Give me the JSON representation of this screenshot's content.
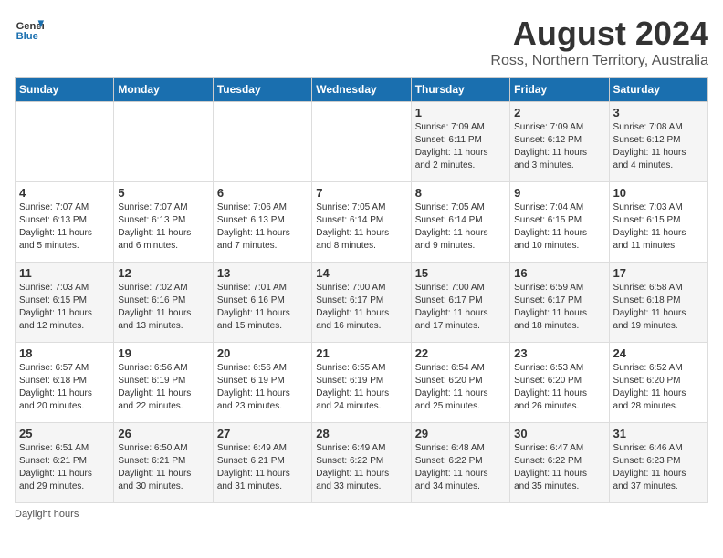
{
  "header": {
    "logo_line1": "General",
    "logo_line2": "Blue",
    "main_title": "August 2024",
    "subtitle": "Ross, Northern Territory, Australia"
  },
  "days_of_week": [
    "Sunday",
    "Monday",
    "Tuesday",
    "Wednesday",
    "Thursday",
    "Friday",
    "Saturday"
  ],
  "weeks": [
    [
      {
        "num": "",
        "info": ""
      },
      {
        "num": "",
        "info": ""
      },
      {
        "num": "",
        "info": ""
      },
      {
        "num": "",
        "info": ""
      },
      {
        "num": "1",
        "info": "Sunrise: 7:09 AM\nSunset: 6:11 PM\nDaylight: 11 hours\nand 2 minutes."
      },
      {
        "num": "2",
        "info": "Sunrise: 7:09 AM\nSunset: 6:12 PM\nDaylight: 11 hours\nand 3 minutes."
      },
      {
        "num": "3",
        "info": "Sunrise: 7:08 AM\nSunset: 6:12 PM\nDaylight: 11 hours\nand 4 minutes."
      }
    ],
    [
      {
        "num": "4",
        "info": "Sunrise: 7:07 AM\nSunset: 6:13 PM\nDaylight: 11 hours\nand 5 minutes."
      },
      {
        "num": "5",
        "info": "Sunrise: 7:07 AM\nSunset: 6:13 PM\nDaylight: 11 hours\nand 6 minutes."
      },
      {
        "num": "6",
        "info": "Sunrise: 7:06 AM\nSunset: 6:13 PM\nDaylight: 11 hours\nand 7 minutes."
      },
      {
        "num": "7",
        "info": "Sunrise: 7:05 AM\nSunset: 6:14 PM\nDaylight: 11 hours\nand 8 minutes."
      },
      {
        "num": "8",
        "info": "Sunrise: 7:05 AM\nSunset: 6:14 PM\nDaylight: 11 hours\nand 9 minutes."
      },
      {
        "num": "9",
        "info": "Sunrise: 7:04 AM\nSunset: 6:15 PM\nDaylight: 11 hours\nand 10 minutes."
      },
      {
        "num": "10",
        "info": "Sunrise: 7:03 AM\nSunset: 6:15 PM\nDaylight: 11 hours\nand 11 minutes."
      }
    ],
    [
      {
        "num": "11",
        "info": "Sunrise: 7:03 AM\nSunset: 6:15 PM\nDaylight: 11 hours\nand 12 minutes."
      },
      {
        "num": "12",
        "info": "Sunrise: 7:02 AM\nSunset: 6:16 PM\nDaylight: 11 hours\nand 13 minutes."
      },
      {
        "num": "13",
        "info": "Sunrise: 7:01 AM\nSunset: 6:16 PM\nDaylight: 11 hours\nand 15 minutes."
      },
      {
        "num": "14",
        "info": "Sunrise: 7:00 AM\nSunset: 6:17 PM\nDaylight: 11 hours\nand 16 minutes."
      },
      {
        "num": "15",
        "info": "Sunrise: 7:00 AM\nSunset: 6:17 PM\nDaylight: 11 hours\nand 17 minutes."
      },
      {
        "num": "16",
        "info": "Sunrise: 6:59 AM\nSunset: 6:17 PM\nDaylight: 11 hours\nand 18 minutes."
      },
      {
        "num": "17",
        "info": "Sunrise: 6:58 AM\nSunset: 6:18 PM\nDaylight: 11 hours\nand 19 minutes."
      }
    ],
    [
      {
        "num": "18",
        "info": "Sunrise: 6:57 AM\nSunset: 6:18 PM\nDaylight: 11 hours\nand 20 minutes."
      },
      {
        "num": "19",
        "info": "Sunrise: 6:56 AM\nSunset: 6:19 PM\nDaylight: 11 hours\nand 22 minutes."
      },
      {
        "num": "20",
        "info": "Sunrise: 6:56 AM\nSunset: 6:19 PM\nDaylight: 11 hours\nand 23 minutes."
      },
      {
        "num": "21",
        "info": "Sunrise: 6:55 AM\nSunset: 6:19 PM\nDaylight: 11 hours\nand 24 minutes."
      },
      {
        "num": "22",
        "info": "Sunrise: 6:54 AM\nSunset: 6:20 PM\nDaylight: 11 hours\nand 25 minutes."
      },
      {
        "num": "23",
        "info": "Sunrise: 6:53 AM\nSunset: 6:20 PM\nDaylight: 11 hours\nand 26 minutes."
      },
      {
        "num": "24",
        "info": "Sunrise: 6:52 AM\nSunset: 6:20 PM\nDaylight: 11 hours\nand 28 minutes."
      }
    ],
    [
      {
        "num": "25",
        "info": "Sunrise: 6:51 AM\nSunset: 6:21 PM\nDaylight: 11 hours\nand 29 minutes."
      },
      {
        "num": "26",
        "info": "Sunrise: 6:50 AM\nSunset: 6:21 PM\nDaylight: 11 hours\nand 30 minutes."
      },
      {
        "num": "27",
        "info": "Sunrise: 6:49 AM\nSunset: 6:21 PM\nDaylight: 11 hours\nand 31 minutes."
      },
      {
        "num": "28",
        "info": "Sunrise: 6:49 AM\nSunset: 6:22 PM\nDaylight: 11 hours\nand 33 minutes."
      },
      {
        "num": "29",
        "info": "Sunrise: 6:48 AM\nSunset: 6:22 PM\nDaylight: 11 hours\nand 34 minutes."
      },
      {
        "num": "30",
        "info": "Sunrise: 6:47 AM\nSunset: 6:22 PM\nDaylight: 11 hours\nand 35 minutes."
      },
      {
        "num": "31",
        "info": "Sunrise: 6:46 AM\nSunset: 6:23 PM\nDaylight: 11 hours\nand 37 minutes."
      }
    ]
  ],
  "footer": {
    "daylight_label": "Daylight hours"
  }
}
